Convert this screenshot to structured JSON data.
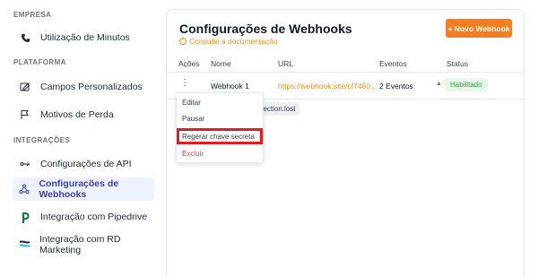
{
  "sidebar": {
    "sections": [
      {
        "title": "EMPRESA"
      },
      {
        "title": "PLATAFORMA"
      },
      {
        "title": "INTEGRAÇÕES"
      }
    ],
    "items": [
      {
        "label": "Utilização de Minutos",
        "icon": "phone-icon"
      },
      {
        "label": "Campos Personalizados",
        "icon": "edit-box-icon"
      },
      {
        "label": "Motivos de Perda",
        "icon": "flag-icon"
      },
      {
        "label": "Configurações de API",
        "icon": "key-icon"
      },
      {
        "label": "Configurações de Webhooks",
        "icon": "webhook-icon",
        "active": true
      },
      {
        "label": "Integração com Pipedrive",
        "icon": "pipedrive-icon"
      },
      {
        "label": "Integração com RD Marketing",
        "icon": "rd-station-icon"
      }
    ]
  },
  "main": {
    "title": "Configurações de Webhooks",
    "doc_link": "Consulte a documentação",
    "new_button": "+ Novo Webhook",
    "table": {
      "headers": [
        "Ações",
        "Nome",
        "URL",
        "Eventos",
        "Status"
      ],
      "rows": [
        {
          "name": "Webhook 1",
          "url": "https://webhook.site/cf7460...",
          "events": "2 Eventos",
          "status": "Habilitado"
        }
      ],
      "expanded_event": "pection.lost"
    }
  },
  "menu": {
    "items": [
      "Editar",
      "Pausar",
      "Regerar chave secreta",
      "Excluir"
    ]
  },
  "colors": {
    "accent": "#f57c1f",
    "active_nav": "#3b3fb6",
    "status_green": "#2e9a3e",
    "danger": "#e23b2e",
    "highlight": "#e31b23"
  }
}
